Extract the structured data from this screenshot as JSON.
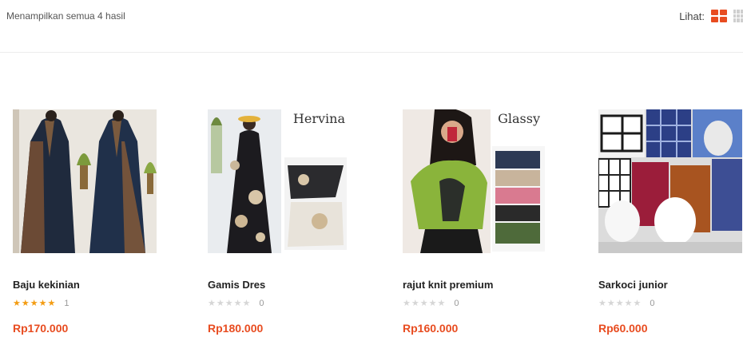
{
  "toolbar": {
    "result_text": "Menampilkan semua 4 hasil",
    "view_label": "Lihat:",
    "grid_view_icon": "grid-icon",
    "list_view_icon": "list-icon",
    "accent_color": "#e84c20"
  },
  "products": [
    {
      "name": "Baju kekinian",
      "rating": 5,
      "rating_count": "1",
      "price": "Rp170.000"
    },
    {
      "name": "Gamis Dres",
      "rating": 0,
      "rating_count": "0",
      "price": "Rp180.000",
      "image_text": "Hervina"
    },
    {
      "name": "rajut knit premium",
      "rating": 0,
      "rating_count": "0",
      "price": "Rp160.000",
      "image_text": "Glassy"
    },
    {
      "name": "Sarkoci junior",
      "rating": 0,
      "rating_count": "0",
      "price": "Rp60.000"
    }
  ]
}
